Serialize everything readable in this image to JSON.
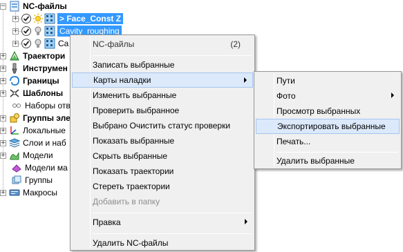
{
  "tree": {
    "root": "NC-файлы",
    "child1": "> Face_Const Z",
    "child2": "Cavity_roughing",
    "child3": "Ca",
    "items": [
      "Траектори",
      "Инструмен",
      "Границы",
      "Шаблоны",
      "Наборы отв",
      "Группы эле",
      "Локальные",
      "Слои и наб",
      "Модели",
      "Модели ма",
      "Группы",
      "Макросы"
    ]
  },
  "context_menu": {
    "header": "NC-файлы",
    "count": "(2)",
    "items": [
      "Записать выбранные",
      "Карты наладки",
      "Изменить выбранные",
      "Проверить выбранное",
      "Выбрано Очистить статус проверки",
      "Показать выбранные",
      "Скрыть выбранные",
      "Показать траектории",
      "Стереть траектории",
      "Добавить в папку",
      "Правка",
      "Удалить NC-файлы"
    ]
  },
  "submenu": {
    "items": [
      "Пути",
      "Фото",
      "Просмотр выбранных",
      "Экспортировать выбранные",
      "Печать...",
      "Удалить выбранные"
    ]
  }
}
